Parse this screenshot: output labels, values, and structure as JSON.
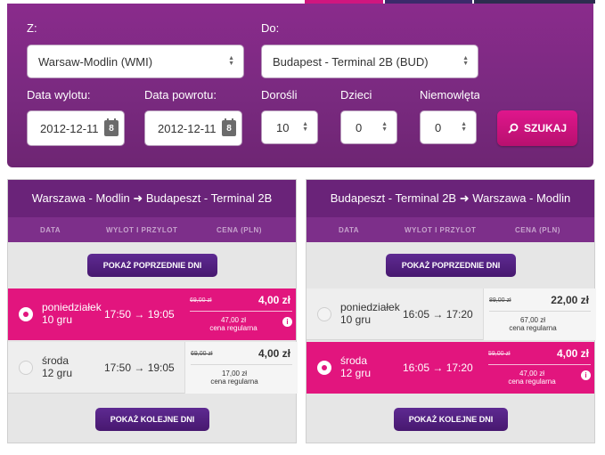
{
  "colors": {
    "panel": "#7a2a80",
    "accent": "#e2157e",
    "header": "#6a2379",
    "pill": "#5e2a92"
  },
  "search": {
    "from_label": "Z:",
    "to_label": "Do:",
    "from_value": "Warsaw-Modlin (WMI)",
    "to_value": "Budapest - Terminal 2B (BUD)",
    "depart_label": "Data wylotu:",
    "return_label": "Data powrotu:",
    "depart_value": "2012-12-11",
    "return_value": "2012-12-11",
    "calendar_day": "8",
    "adults_label": "Dorośli",
    "children_label": "Dzieci",
    "infants_label": "Niemowlęta",
    "adults_value": "10",
    "children_value": "0",
    "infants_value": "0",
    "search_button": "SZUKAJ"
  },
  "columns": {
    "date": "DATA",
    "times": "WYLOT I PRZYLOT",
    "price": "CENA (PLN)"
  },
  "outbound": {
    "title": "Warszawa - Modlin ➜ Budapeszt - Terminal 2B",
    "prev_button": "POKAŻ POPRZEDNIE DNI",
    "next_button": "POKAŻ KOLEJNE DNI",
    "rows": [
      {
        "day": "poniedziałek",
        "date": "10 gru",
        "times": "17:50 → 19:05",
        "old_price": "69,00 zł",
        "price": "4,00 zł",
        "regular_price": "47,00 zł",
        "regular_label": "cena regularna",
        "selected": true
      },
      {
        "day": "środa",
        "date": "12 gru",
        "times": "17:50 → 19:05",
        "old_price": "69,00 zł",
        "price": "4,00 zł",
        "regular_price": "17,00 zł",
        "regular_label": "cena regularna",
        "selected": false
      }
    ]
  },
  "inbound": {
    "title": "Budapeszt - Terminal 2B ➜ Warszawa - Modlin",
    "prev_button": "POKAŻ POPRZEDNIE DNI",
    "next_button": "POKAŻ KOLEJNE DNI",
    "rows": [
      {
        "day": "poniedziałek",
        "date": "10 gru",
        "times": "16:05 → 17:20",
        "old_price": "89,00 zł",
        "price": "22,00 zł",
        "regular_price": "67,00 zł",
        "regular_label": "cena regularna",
        "selected": false
      },
      {
        "day": "środa",
        "date": "12 gru",
        "times": "16:05 → 17:20",
        "old_price": "59,00 zł",
        "price": "4,00 zł",
        "regular_price": "47,00 zł",
        "regular_label": "cena regularna",
        "selected": true
      }
    ]
  }
}
